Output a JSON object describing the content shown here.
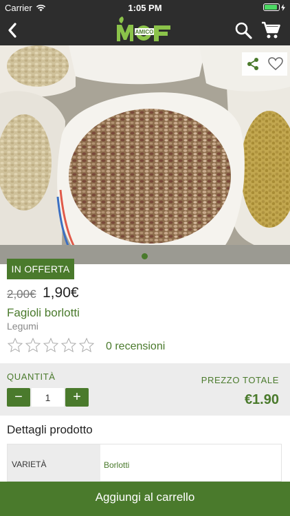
{
  "status_bar": {
    "carrier": "Carrier",
    "time": "1:05 PM",
    "battery_level": 0.9
  },
  "nav": {
    "logo_text": "MOF",
    "logo_subtext": "AMICO"
  },
  "product": {
    "offer_badge": "IN OFFERTA",
    "old_price": "2,00€",
    "new_price": "1,90€",
    "name": "Fagioli borlotti",
    "category": "Legumi",
    "rating": 0,
    "rating_max": 5,
    "reviews_label": "0 recensioni"
  },
  "quantity": {
    "label": "QUANTITÀ",
    "minus": "−",
    "plus": "+",
    "value": "1"
  },
  "total": {
    "label": "PREZZO TOTALE",
    "value": "€1.90"
  },
  "details": {
    "title": "Dettagli prodotto",
    "rows": [
      {
        "key": "VARIETÀ",
        "value": "Borlotti"
      }
    ]
  },
  "cta": {
    "add_to_cart": "Aggiungi al carrello"
  },
  "colors": {
    "brand_green": "#4a7a2c",
    "nav_background": "#2d2d2d"
  }
}
